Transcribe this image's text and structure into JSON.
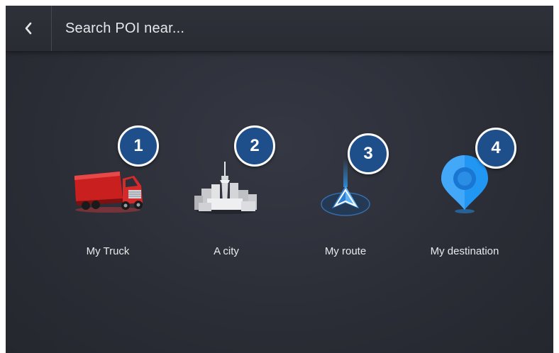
{
  "header": {
    "back_icon": "chevron-left-icon",
    "title": "Search POI near..."
  },
  "options": [
    {
      "label": "My Truck",
      "icon": "truck-icon",
      "badge": "1"
    },
    {
      "label": "A city",
      "icon": "city-icon",
      "badge": "2"
    },
    {
      "label": "My route",
      "icon": "route-arrow-icon",
      "badge": "3"
    },
    {
      "label": "My destination",
      "icon": "destination-pin-icon",
      "badge": "4"
    }
  ],
  "colors": {
    "background": "#2b2d36",
    "badge_fill": "#1f4f8a",
    "truck_red": "#d62a2a",
    "pin_blue": "#2196f3"
  }
}
